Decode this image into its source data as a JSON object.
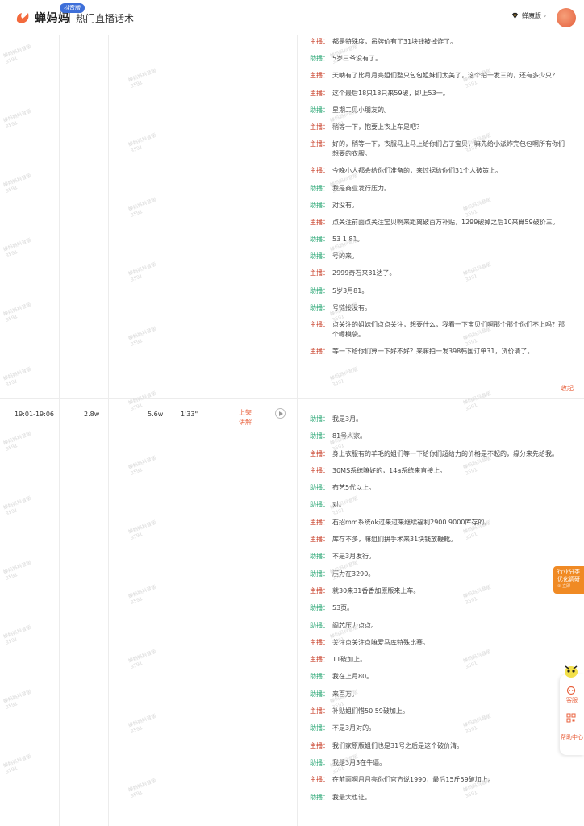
{
  "header": {
    "logo_text": "蝉妈妈",
    "logo_badge": "抖音版",
    "title": "热门直播话术",
    "user_name": "蝉魔版",
    "user_caret": "›"
  },
  "speakers": {
    "host": "主播：",
    "assistant": "助播："
  },
  "row1": {
    "lines": [
      {
        "s": "host",
        "t": "都是特殊度，吊牌价有了31块钱被掉炸了。"
      },
      {
        "s": "assistant",
        "t": "5岁三爷没有了。"
      },
      {
        "s": "host",
        "t": "天呐有了比月月亮姐们整只包包姐妹们太美了，这个拍一发三的，还有多少只？"
      },
      {
        "s": "host",
        "t": "这个最后18只18只来59破，即上53一。"
      },
      {
        "s": "assistant",
        "t": "星期二见小朋友的。"
      },
      {
        "s": "host",
        "t": "稍等一下，抱要上衣上车是吧？"
      },
      {
        "s": "host",
        "t": "好的，稍等一下，衣服马上马上给你们占了宝贝，嘛先给小派炸完包包啊所有你们想要的衣服。"
      },
      {
        "s": "host",
        "t": "今晚小人都会给你们准备的，来过据给你们31个人破策上。"
      },
      {
        "s": "assistant",
        "t": "我是商业发行压力。"
      },
      {
        "s": "assistant",
        "t": "对没有。"
      },
      {
        "s": "host",
        "t": "点关注前面点关注宝贝啊来距离破百万补贴，1299破掉之后10来算59破价三。"
      },
      {
        "s": "assistant",
        "t": "53 1 81。"
      },
      {
        "s": "assistant",
        "t": "号的来。"
      },
      {
        "s": "host",
        "t": "2999奇石来31达了。"
      },
      {
        "s": "assistant",
        "t": "5岁3月81。"
      },
      {
        "s": "assistant",
        "t": "号链接没有。"
      },
      {
        "s": "host",
        "t": "点关注的姐妹们点点关注，想要什么，我看一下宝贝们啊那个那个你们不上吗？那个嗯模袋。"
      },
      {
        "s": "host",
        "t": "等一下给你们算一下好不好？来嘛拍一发398韩国订单31，货价清了。"
      }
    ],
    "collapse_label": "收起"
  },
  "row2": {
    "time": "19:01-19:06",
    "sales": "2.8w",
    "viewers": "5.6w",
    "duration": "1'33\"",
    "action_label": "上架讲解",
    "lines": [
      {
        "s": "assistant",
        "t": "我是3月。"
      },
      {
        "s": "assistant",
        "t": "81号人家。"
      },
      {
        "s": "host",
        "t": "身上衣服有的羊毛的姐们等一下给你们超给力的价格是不起的，缘分来先给我。"
      },
      {
        "s": "host",
        "t": "30MS系统嘛好的，14a系统来直接上。"
      },
      {
        "s": "assistant",
        "t": "布艺5代以上。"
      },
      {
        "s": "assistant",
        "t": "对。"
      },
      {
        "s": "host",
        "t": "石招mm系统ok过来过来继续福利2900 9000库存的。"
      },
      {
        "s": "host",
        "t": "库存不多，嘛姐们拼手术来31块钱放鞭靴。"
      },
      {
        "s": "assistant",
        "t": "不是3月发行。"
      },
      {
        "s": "assistant",
        "t": "压力在3290。"
      },
      {
        "s": "host",
        "t": "就30来31香香加原版来上车。"
      },
      {
        "s": "assistant",
        "t": "53页。"
      },
      {
        "s": "assistant",
        "t": "阁芯压力点点。"
      },
      {
        "s": "host",
        "t": "关注点关注点嘛爱马库特殊比赛。"
      },
      {
        "s": "host",
        "t": "11破加上。"
      },
      {
        "s": "assistant",
        "t": "我在上月80。"
      },
      {
        "s": "assistant",
        "t": "来百万。"
      },
      {
        "s": "host",
        "t": "补贴姐们惜50 59破加上。"
      },
      {
        "s": "assistant",
        "t": "不是3月对的。"
      },
      {
        "s": "host",
        "t": "我们家原版姐们也是31号之后是这个破价清。"
      },
      {
        "s": "assistant",
        "t": "我是3月3在牛逼。"
      },
      {
        "s": "host",
        "t": "在前面啊月月亮你们官方说1990，最后15斤59破加上。"
      },
      {
        "s": "assistant",
        "t": "我最大也让。"
      }
    ]
  },
  "widgets": {
    "promo_line1": "行业分类",
    "promo_line2": "优化调研",
    "promo_sub": "① 立即",
    "service_label": "客服",
    "help_label": "帮助中心"
  },
  "watermark": "蝉妈妈抖音版\n3591",
  "colors": {
    "brand": "#e8603c",
    "host": "#c9402a",
    "assistant": "#2ca876",
    "promo": "#f08a24"
  }
}
